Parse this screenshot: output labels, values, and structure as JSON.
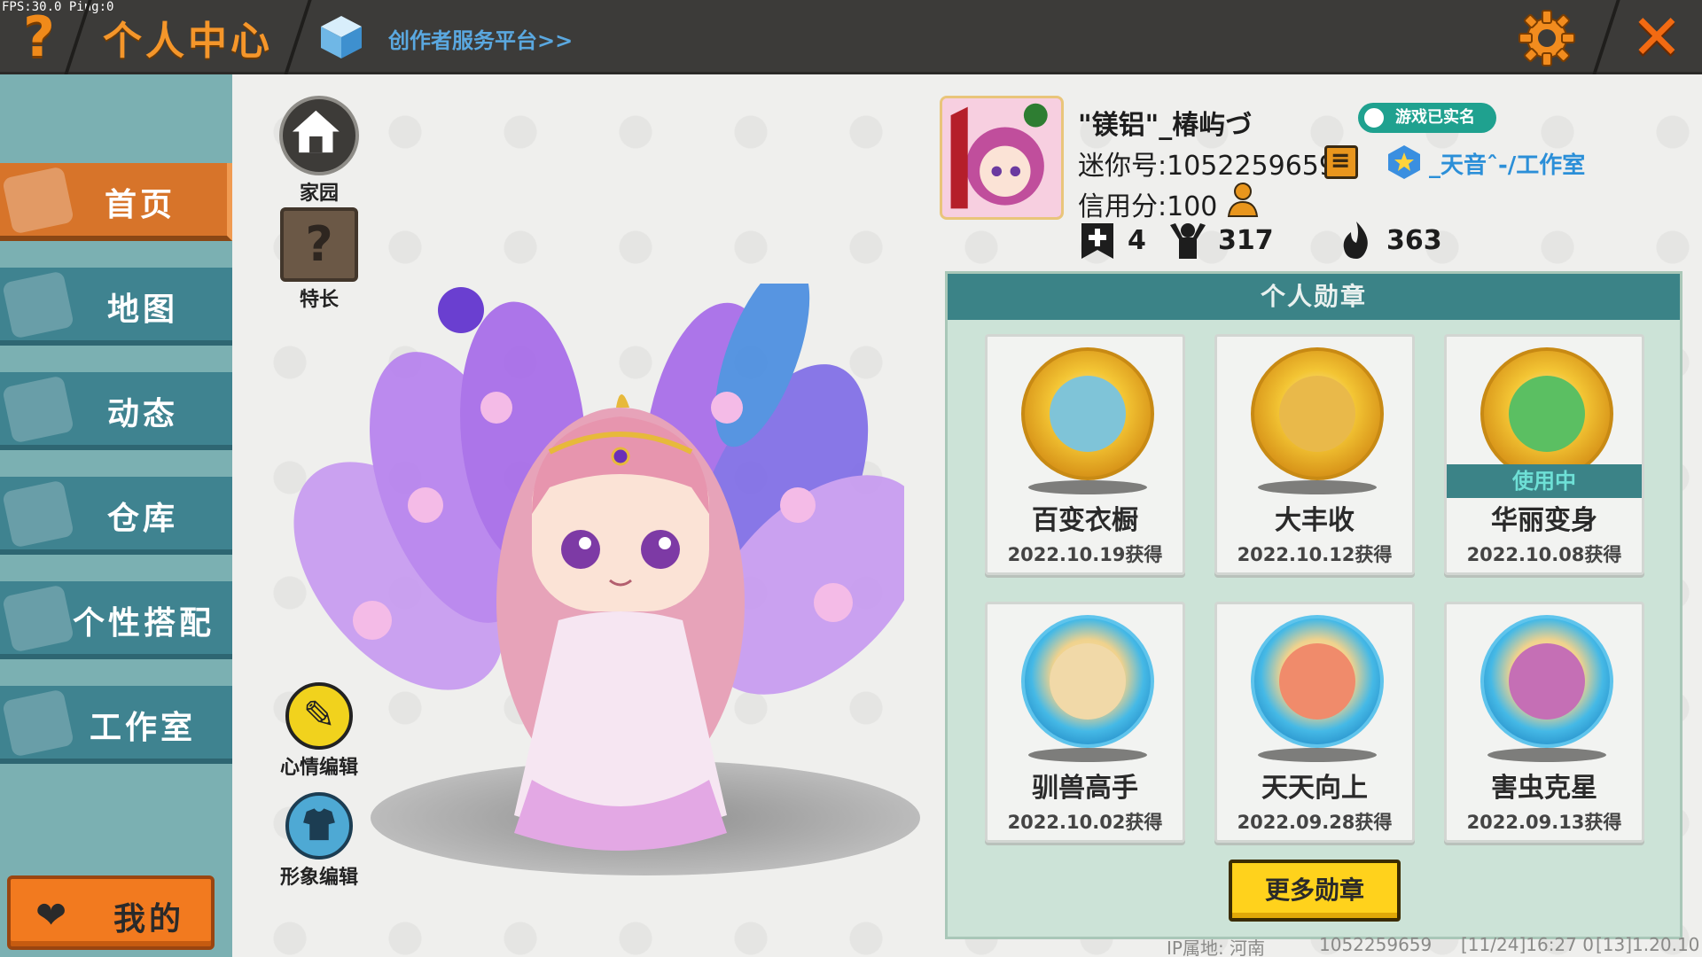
{
  "debug": {
    "fps": "FPS:30.0  Ping:0"
  },
  "header": {
    "title": "个人中心",
    "creator_link": "创作者服务平台>>"
  },
  "sidebar": {
    "items": [
      {
        "label": "首页",
        "active": true
      },
      {
        "label": "地图",
        "active": false
      },
      {
        "label": "动态",
        "active": false
      },
      {
        "label": "仓库",
        "active": false
      },
      {
        "label": "个性搭配",
        "active": false
      },
      {
        "label": "工作室",
        "active": false
      }
    ],
    "mine_label": "我的"
  },
  "tools": {
    "home": "家园",
    "skill": "特长",
    "mood_edit": "心情编辑",
    "avatar_edit": "形象编辑"
  },
  "profile": {
    "nickname": "\"镁铝\"_椿屿づ",
    "realname_badge": "游戏已实名",
    "mini_id": "迷你号:1052259659",
    "studio": "_天音ˆ-/工作室",
    "credit": "信用分:100",
    "stats": {
      "friends": "4",
      "fans": "317",
      "popularity": "363"
    }
  },
  "medals": {
    "header": "个人勋章",
    "in_use_label": "使用中",
    "items": [
      {
        "name": "百变衣橱",
        "date": "2022.10.19获得",
        "style": "gold",
        "in_use": false
      },
      {
        "name": "大丰收",
        "date": "2022.10.12获得",
        "style": "gold",
        "in_use": false
      },
      {
        "name": "华丽变身",
        "date": "2022.10.08获得",
        "style": "gold",
        "in_use": true
      },
      {
        "name": "驯兽高手",
        "date": "2022.10.02获得",
        "style": "blue",
        "in_use": false
      },
      {
        "name": "天天向上",
        "date": "2022.09.28获得",
        "style": "blue",
        "in_use": false
      },
      {
        "name": "害虫克星",
        "date": "2022.09.13获得",
        "style": "blue",
        "in_use": false
      }
    ],
    "more_button": "更多勋章"
  },
  "footer": {
    "ip": "IP属地: 河南",
    "uid": "1052259659",
    "time": "[11/24]16:27 0",
    "version": "[13]1.20.10"
  },
  "colors": {
    "accent_orange": "#f5962a",
    "sidebar_teal": "#3f8390",
    "active_orange": "#d7742a",
    "medal_panel": "#cce3d7",
    "button_yellow": "#ffd21c"
  }
}
